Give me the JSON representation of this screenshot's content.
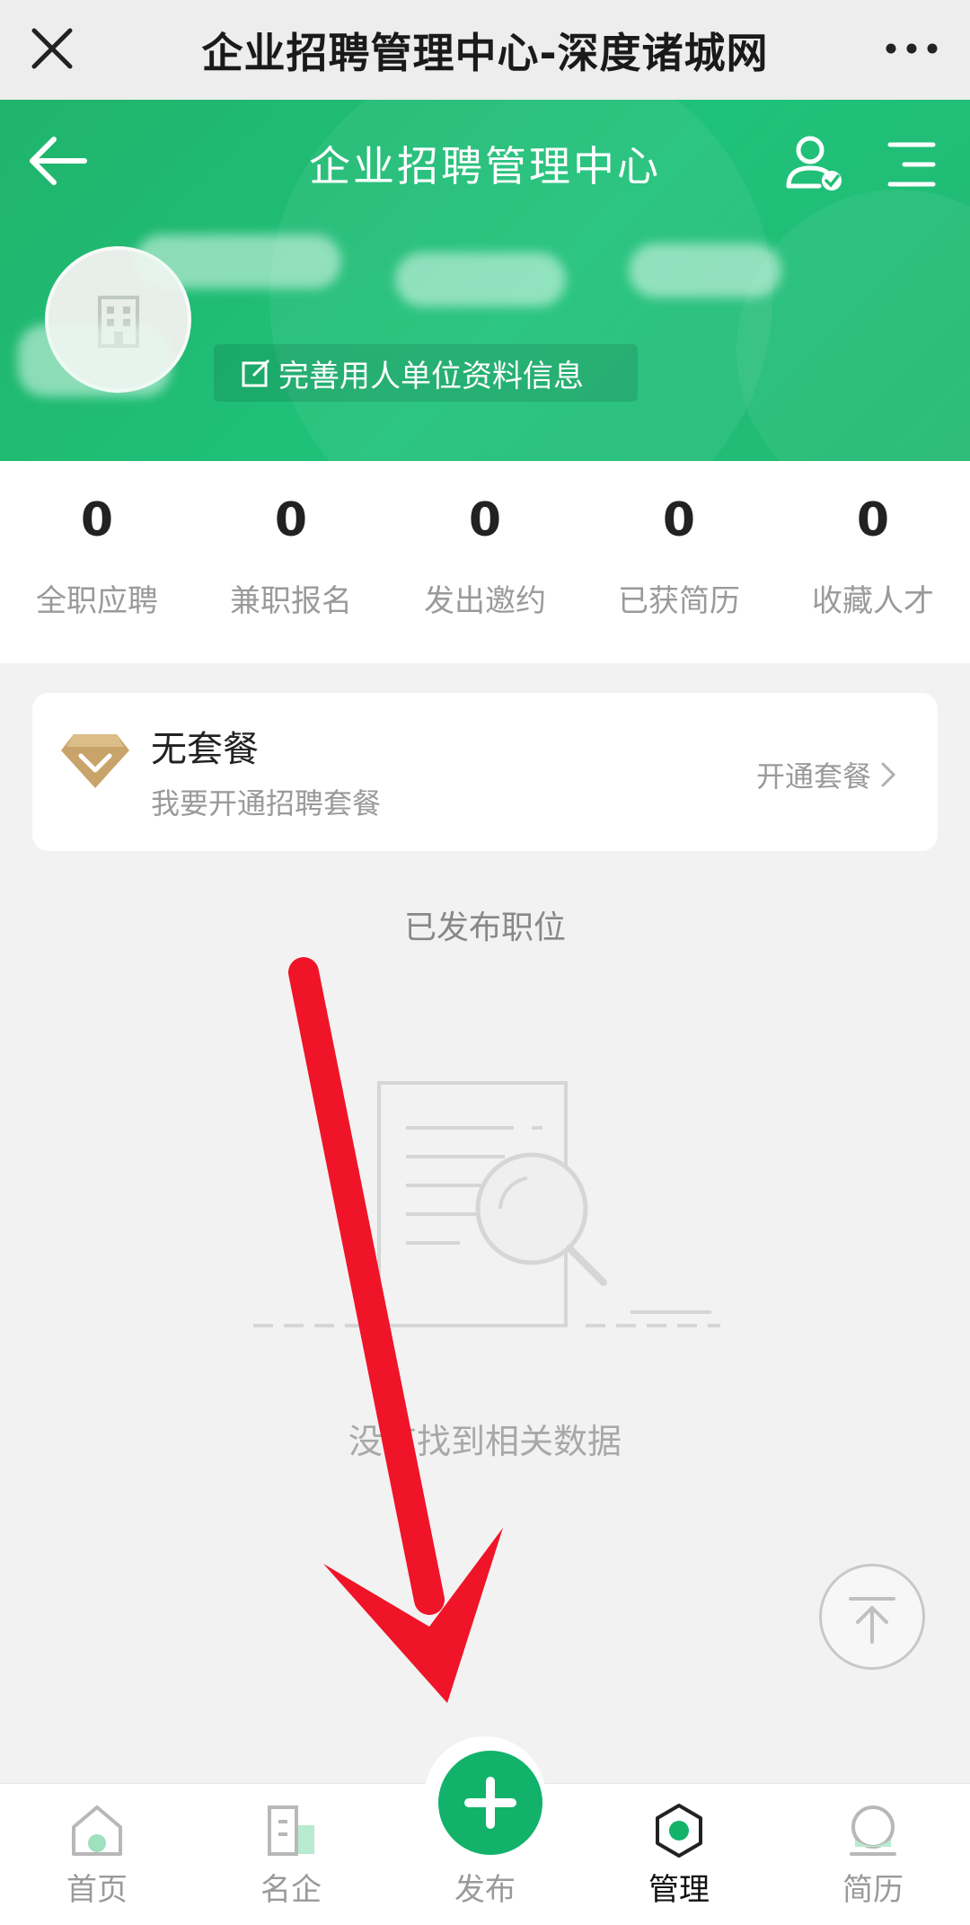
{
  "window": {
    "title": "企业招聘管理中心-深度诸城网"
  },
  "header": {
    "title": "企业招聘管理中心",
    "profile_link": "完善用人单位资料信息"
  },
  "stats": [
    {
      "value": "0",
      "label": "全职应聘"
    },
    {
      "value": "0",
      "label": "兼职报名"
    },
    {
      "value": "0",
      "label": "发出邀约"
    },
    {
      "value": "0",
      "label": "已获简历"
    },
    {
      "value": "0",
      "label": "收藏人才"
    }
  ],
  "package": {
    "title": "无套餐",
    "subtitle": "我要开通招聘套餐",
    "action": "开通套餐"
  },
  "jobs": {
    "section_title": "已发布职位",
    "empty_text": "没有找到相关数据"
  },
  "tabbar": {
    "items": [
      {
        "label": "首页",
        "icon": "home-icon"
      },
      {
        "label": "名企",
        "icon": "building-icon"
      },
      {
        "label": "发布",
        "icon": "plus-icon"
      },
      {
        "label": "管理",
        "icon": "manage-icon"
      },
      {
        "label": "简历",
        "icon": "resume-icon"
      }
    ],
    "active": "管理"
  },
  "colors": {
    "brand": "#1fbf75",
    "background": "#f2f2f2",
    "annotation": "#f01428"
  }
}
